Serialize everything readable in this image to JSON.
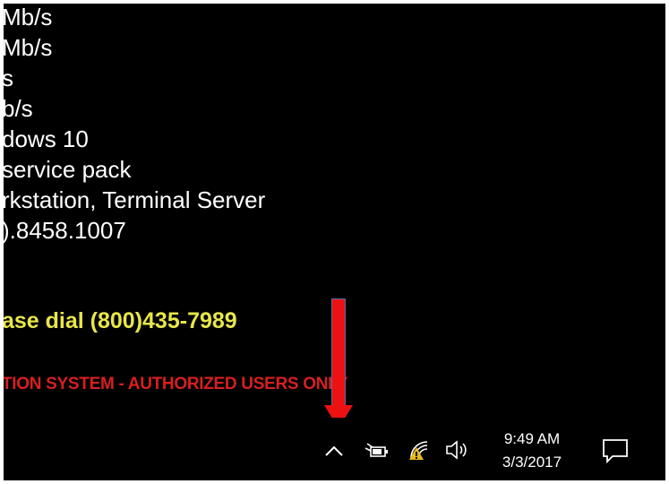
{
  "system_info": {
    "lines": [
      "Mb/s",
      "Mb/s",
      "s",
      "b/s",
      "dows 10",
      "service pack",
      "rkstation, Terminal Server",
      ").8458.1007"
    ]
  },
  "contact_line": "ase dial (800)435-7989",
  "warning_line": "TION SYSTEM - AUTHORIZED USERS ONLY",
  "annotation": {
    "color": "#ee1111"
  },
  "taskbar": {
    "tray_icons": [
      "chevron-up-icon",
      "power-icon",
      "network-icon",
      "volume-icon"
    ],
    "clock": {
      "time": "9:49 AM",
      "date": "3/3/2017"
    },
    "notifications_icon": "action-center-icon"
  },
  "colors": {
    "background": "#000000",
    "text": "#ffffff",
    "contact": "#e8e64a",
    "warning": "#d81f1f"
  }
}
